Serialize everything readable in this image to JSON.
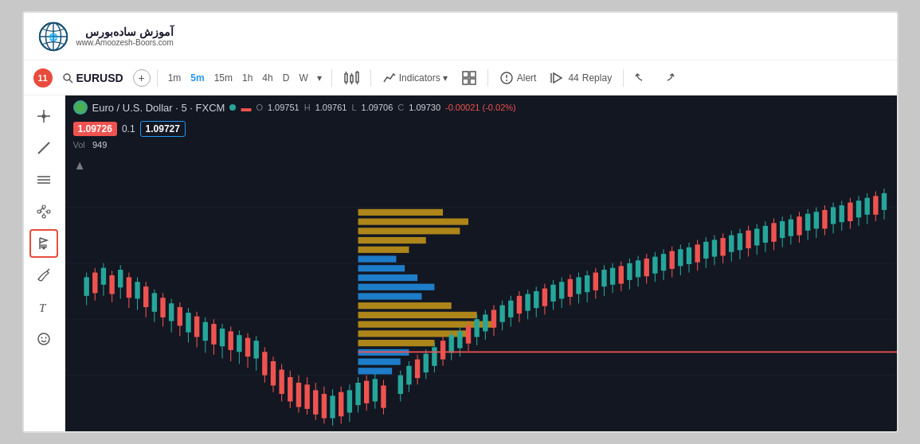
{
  "logo": {
    "title": "آموزش ساده‌بورس",
    "url": "www.Amoozesh-Boors.com"
  },
  "toolbar": {
    "notification_count": "11",
    "symbol": "EURUSD",
    "add_label": "+",
    "timeframes": [
      {
        "label": "1m",
        "active": false
      },
      {
        "label": "5m",
        "active": true
      },
      {
        "label": "15m",
        "active": false
      },
      {
        "label": "1h",
        "active": false
      },
      {
        "label": "4h",
        "active": false
      },
      {
        "label": "D",
        "active": false
      },
      {
        "label": "W",
        "active": false
      }
    ],
    "dropdown_arrow": "▾",
    "chart_type_icon": "⫿",
    "indicators_label": "Indicators",
    "indicators_arrow": "▾",
    "layout_icon": "⊞",
    "alert_label": "Alert",
    "replay_count": "44",
    "replay_label": "Replay",
    "undo_icon": "↩",
    "redo_icon": "↪"
  },
  "chart": {
    "pair_name": "Euro / U.S. Dollar · 5 · FXCM",
    "price_red": "1.09726",
    "decimal": "0.1",
    "price_blue": "1.09727",
    "open_label": "O",
    "open_val": "1.09751",
    "high_label": "H",
    "high_val": "1.09761",
    "low_label": "L",
    "low_val": "1.09706",
    "close_label": "C",
    "close_val": "1.09730",
    "change": "-0.00021 (-0.02%)",
    "vol_label": "Vol",
    "vol_val": "949"
  },
  "tools": [
    {
      "name": "crosshair",
      "icon": "✛"
    },
    {
      "name": "line",
      "icon": "╱"
    },
    {
      "name": "horizontal-lines",
      "icon": "☰"
    },
    {
      "name": "network",
      "icon": "⋰"
    },
    {
      "name": "flag-pin",
      "icon": "⚑",
      "active": true
    },
    {
      "name": "brush",
      "icon": "∿"
    },
    {
      "name": "text",
      "icon": "T"
    },
    {
      "name": "emoji",
      "icon": "☺"
    }
  ]
}
